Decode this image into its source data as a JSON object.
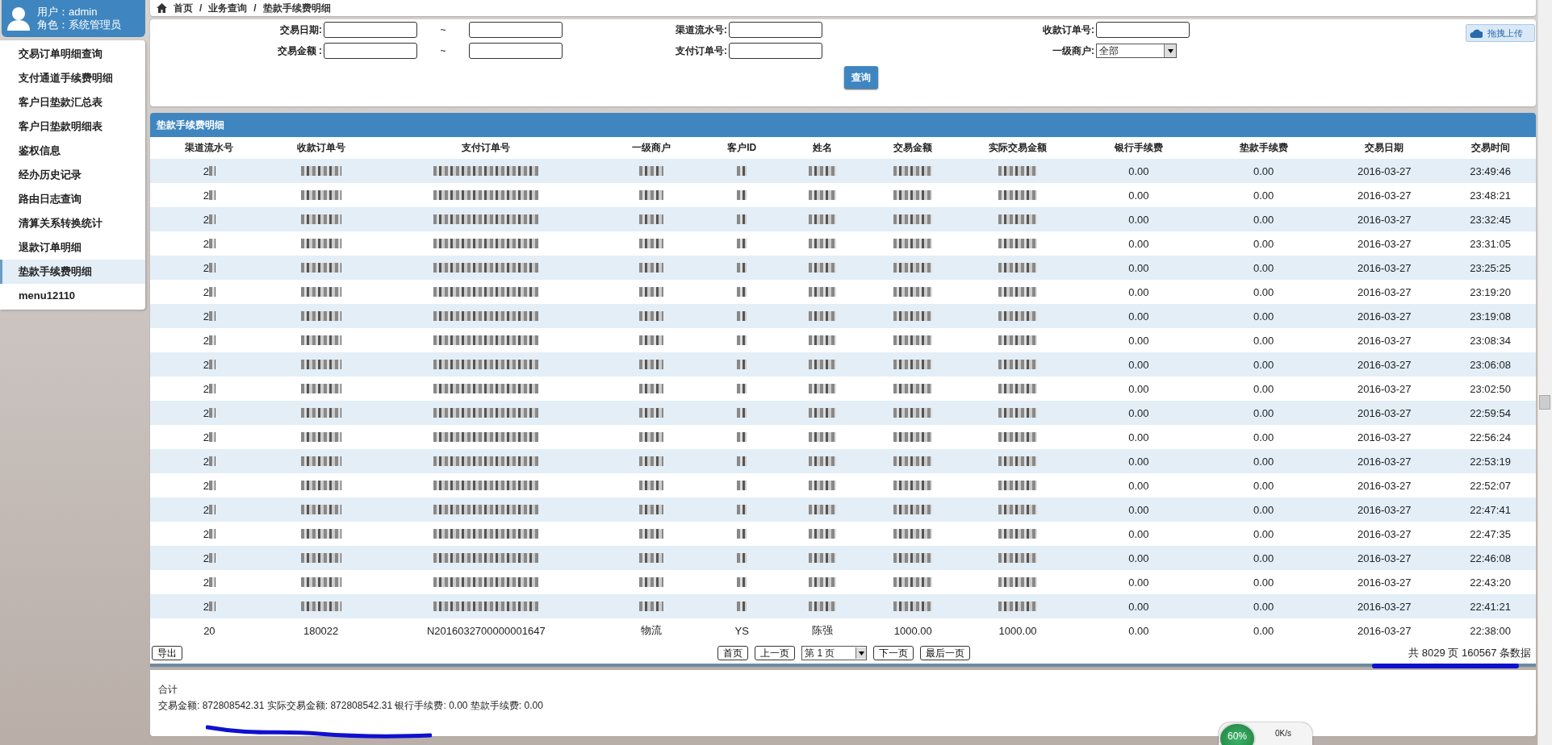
{
  "user_panel": {
    "user": "用户：admin",
    "role": "角色：系统管理员"
  },
  "menu": [
    {
      "label": "交易订单明细查询",
      "selected": false
    },
    {
      "label": "支付通道手续费明细",
      "selected": false
    },
    {
      "label": "客户日垫款汇总表",
      "selected": false
    },
    {
      "label": "客户日垫款明细表",
      "selected": false
    },
    {
      "label": "鉴权信息",
      "selected": false
    },
    {
      "label": "经办历史记录",
      "selected": false
    },
    {
      "label": "路由日志查询",
      "selected": false
    },
    {
      "label": "清算关系转换统计",
      "selected": false
    },
    {
      "label": "退款订单明细",
      "selected": false
    },
    {
      "label": "垫款手续费明细",
      "selected": true
    },
    {
      "label": "menu12110",
      "selected": false
    }
  ],
  "breadcrumb": {
    "items": [
      "首页",
      "业务查询",
      "垫款手续费明细"
    ],
    "separator": "/"
  },
  "upload_button": "拖拽上传",
  "filter_rows": [
    [
      {
        "kind": "range",
        "label": "交易日期:",
        "separator": "~"
      },
      {
        "kind": "text",
        "label": "渠道流水号:"
      },
      {
        "kind": "text",
        "label": "收款订单号:"
      }
    ],
    [
      {
        "kind": "range",
        "label": "交易金额 :",
        "separator": "~"
      },
      {
        "kind": "text",
        "label": "支付订单号:"
      },
      {
        "kind": "select",
        "label": "一级商户:",
        "value": "全部"
      }
    ]
  ],
  "query_button": "查询",
  "table": {
    "title": "垫款手续费明细",
    "columns": [
      "渠道流水号",
      "收款订单号",
      "支付订单号",
      "一级商户",
      "客户ID",
      "姓名",
      "交易金额",
      "实际交易金额",
      "银行手续费",
      "垫款手续费",
      "交易日期",
      "交易时间"
    ],
    "rows": [
      {
        "redacted": true,
        "cells": [
          "2",
          "",
          "",
          "",
          "",
          "",
          "",
          "",
          "0.00",
          "0.00",
          "2016-03-27",
          "23:49:46"
        ]
      },
      {
        "redacted": true,
        "cells": [
          "2",
          "",
          "",
          "",
          "",
          "",
          "",
          "",
          "0.00",
          "0.00",
          "2016-03-27",
          "23:48:21"
        ]
      },
      {
        "redacted": true,
        "cells": [
          "2",
          "",
          "",
          "",
          "",
          "",
          "",
          "",
          "0.00",
          "0.00",
          "2016-03-27",
          "23:32:45"
        ]
      },
      {
        "redacted": true,
        "cells": [
          "2",
          "",
          "",
          "",
          "",
          "",
          "",
          "",
          "0.00",
          "0.00",
          "2016-03-27",
          "23:31:05"
        ]
      },
      {
        "redacted": true,
        "cells": [
          "2",
          "",
          "",
          "",
          "",
          "",
          "",
          "",
          "0.00",
          "0.00",
          "2016-03-27",
          "23:25:25"
        ]
      },
      {
        "redacted": true,
        "cells": [
          "2",
          "",
          "",
          "",
          "",
          "",
          "",
          "",
          "0.00",
          "0.00",
          "2016-03-27",
          "23:19:20"
        ]
      },
      {
        "redacted": true,
        "cells": [
          "2",
          "",
          "",
          "",
          "",
          "",
          "",
          "",
          "0.00",
          "0.00",
          "2016-03-27",
          "23:19:08"
        ]
      },
      {
        "redacted": true,
        "cells": [
          "2",
          "",
          "",
          "",
          "",
          "",
          "",
          "",
          "0.00",
          "0.00",
          "2016-03-27",
          "23:08:34"
        ]
      },
      {
        "redacted": true,
        "cells": [
          "2",
          "",
          "",
          "",
          "",
          "",
          "",
          "",
          "0.00",
          "0.00",
          "2016-03-27",
          "23:06:08"
        ]
      },
      {
        "redacted": true,
        "cells": [
          "2",
          "",
          "",
          "",
          "",
          "",
          "",
          "",
          "0.00",
          "0.00",
          "2016-03-27",
          "23:02:50"
        ]
      },
      {
        "redacted": true,
        "cells": [
          "2",
          "",
          "",
          "",
          "",
          "",
          "",
          "",
          "0.00",
          "0.00",
          "2016-03-27",
          "22:59:54"
        ]
      },
      {
        "redacted": true,
        "cells": [
          "2",
          "",
          "",
          "",
          "",
          "",
          "",
          "",
          "0.00",
          "0.00",
          "2016-03-27",
          "22:56:24"
        ]
      },
      {
        "redacted": true,
        "cells": [
          "2",
          "",
          "",
          "",
          "",
          "",
          "",
          "",
          "0.00",
          "0.00",
          "2016-03-27",
          "22:53:19"
        ]
      },
      {
        "redacted": true,
        "cells": [
          "2",
          "",
          "",
          "",
          "",
          "",
          "",
          "",
          "0.00",
          "0.00",
          "2016-03-27",
          "22:52:07"
        ]
      },
      {
        "redacted": true,
        "cells": [
          "2",
          "",
          "",
          "",
          "",
          "",
          "",
          "",
          "0.00",
          "0.00",
          "2016-03-27",
          "22:47:41"
        ]
      },
      {
        "redacted": true,
        "cells": [
          "2",
          "",
          "",
          "",
          "",
          "",
          "",
          "",
          "0.00",
          "0.00",
          "2016-03-27",
          "22:47:35"
        ]
      },
      {
        "redacted": true,
        "cells": [
          "2",
          "",
          "",
          "",
          "",
          "",
          "",
          "",
          "0.00",
          "0.00",
          "2016-03-27",
          "22:46:08"
        ]
      },
      {
        "redacted": true,
        "cells": [
          "2",
          "",
          "",
          "",
          "",
          "",
          "",
          "",
          "0.00",
          "0.00",
          "2016-03-27",
          "22:43:20"
        ]
      },
      {
        "redacted": true,
        "cells": [
          "2",
          "",
          "",
          "",
          "",
          "",
          "",
          "",
          "0.00",
          "0.00",
          "2016-03-27",
          "22:41:21"
        ]
      },
      {
        "redacted": false,
        "cells": [
          "20",
          "180022",
          "N2016032700000001647",
          "物流",
          "YS",
          "陈强",
          "1000.00",
          "1000.00",
          "0.00",
          "0.00",
          "2016-03-27",
          "22:38:00"
        ]
      }
    ]
  },
  "export_button": "导出",
  "pager": {
    "first": "首页",
    "prev": "上一页",
    "page": "第 1 页",
    "next": "下一页",
    "last": "最后一页",
    "summary": "共 8029 页 160567 条数据"
  },
  "totals": {
    "title": "合计",
    "line": "交易金额: 872808542.31 实际交易金额: 872808542.31 银行手续费: 0.00 垫款手续费: 0.00"
  },
  "speed_widget": {
    "percent": "60%",
    "speed": "0K/s"
  }
}
